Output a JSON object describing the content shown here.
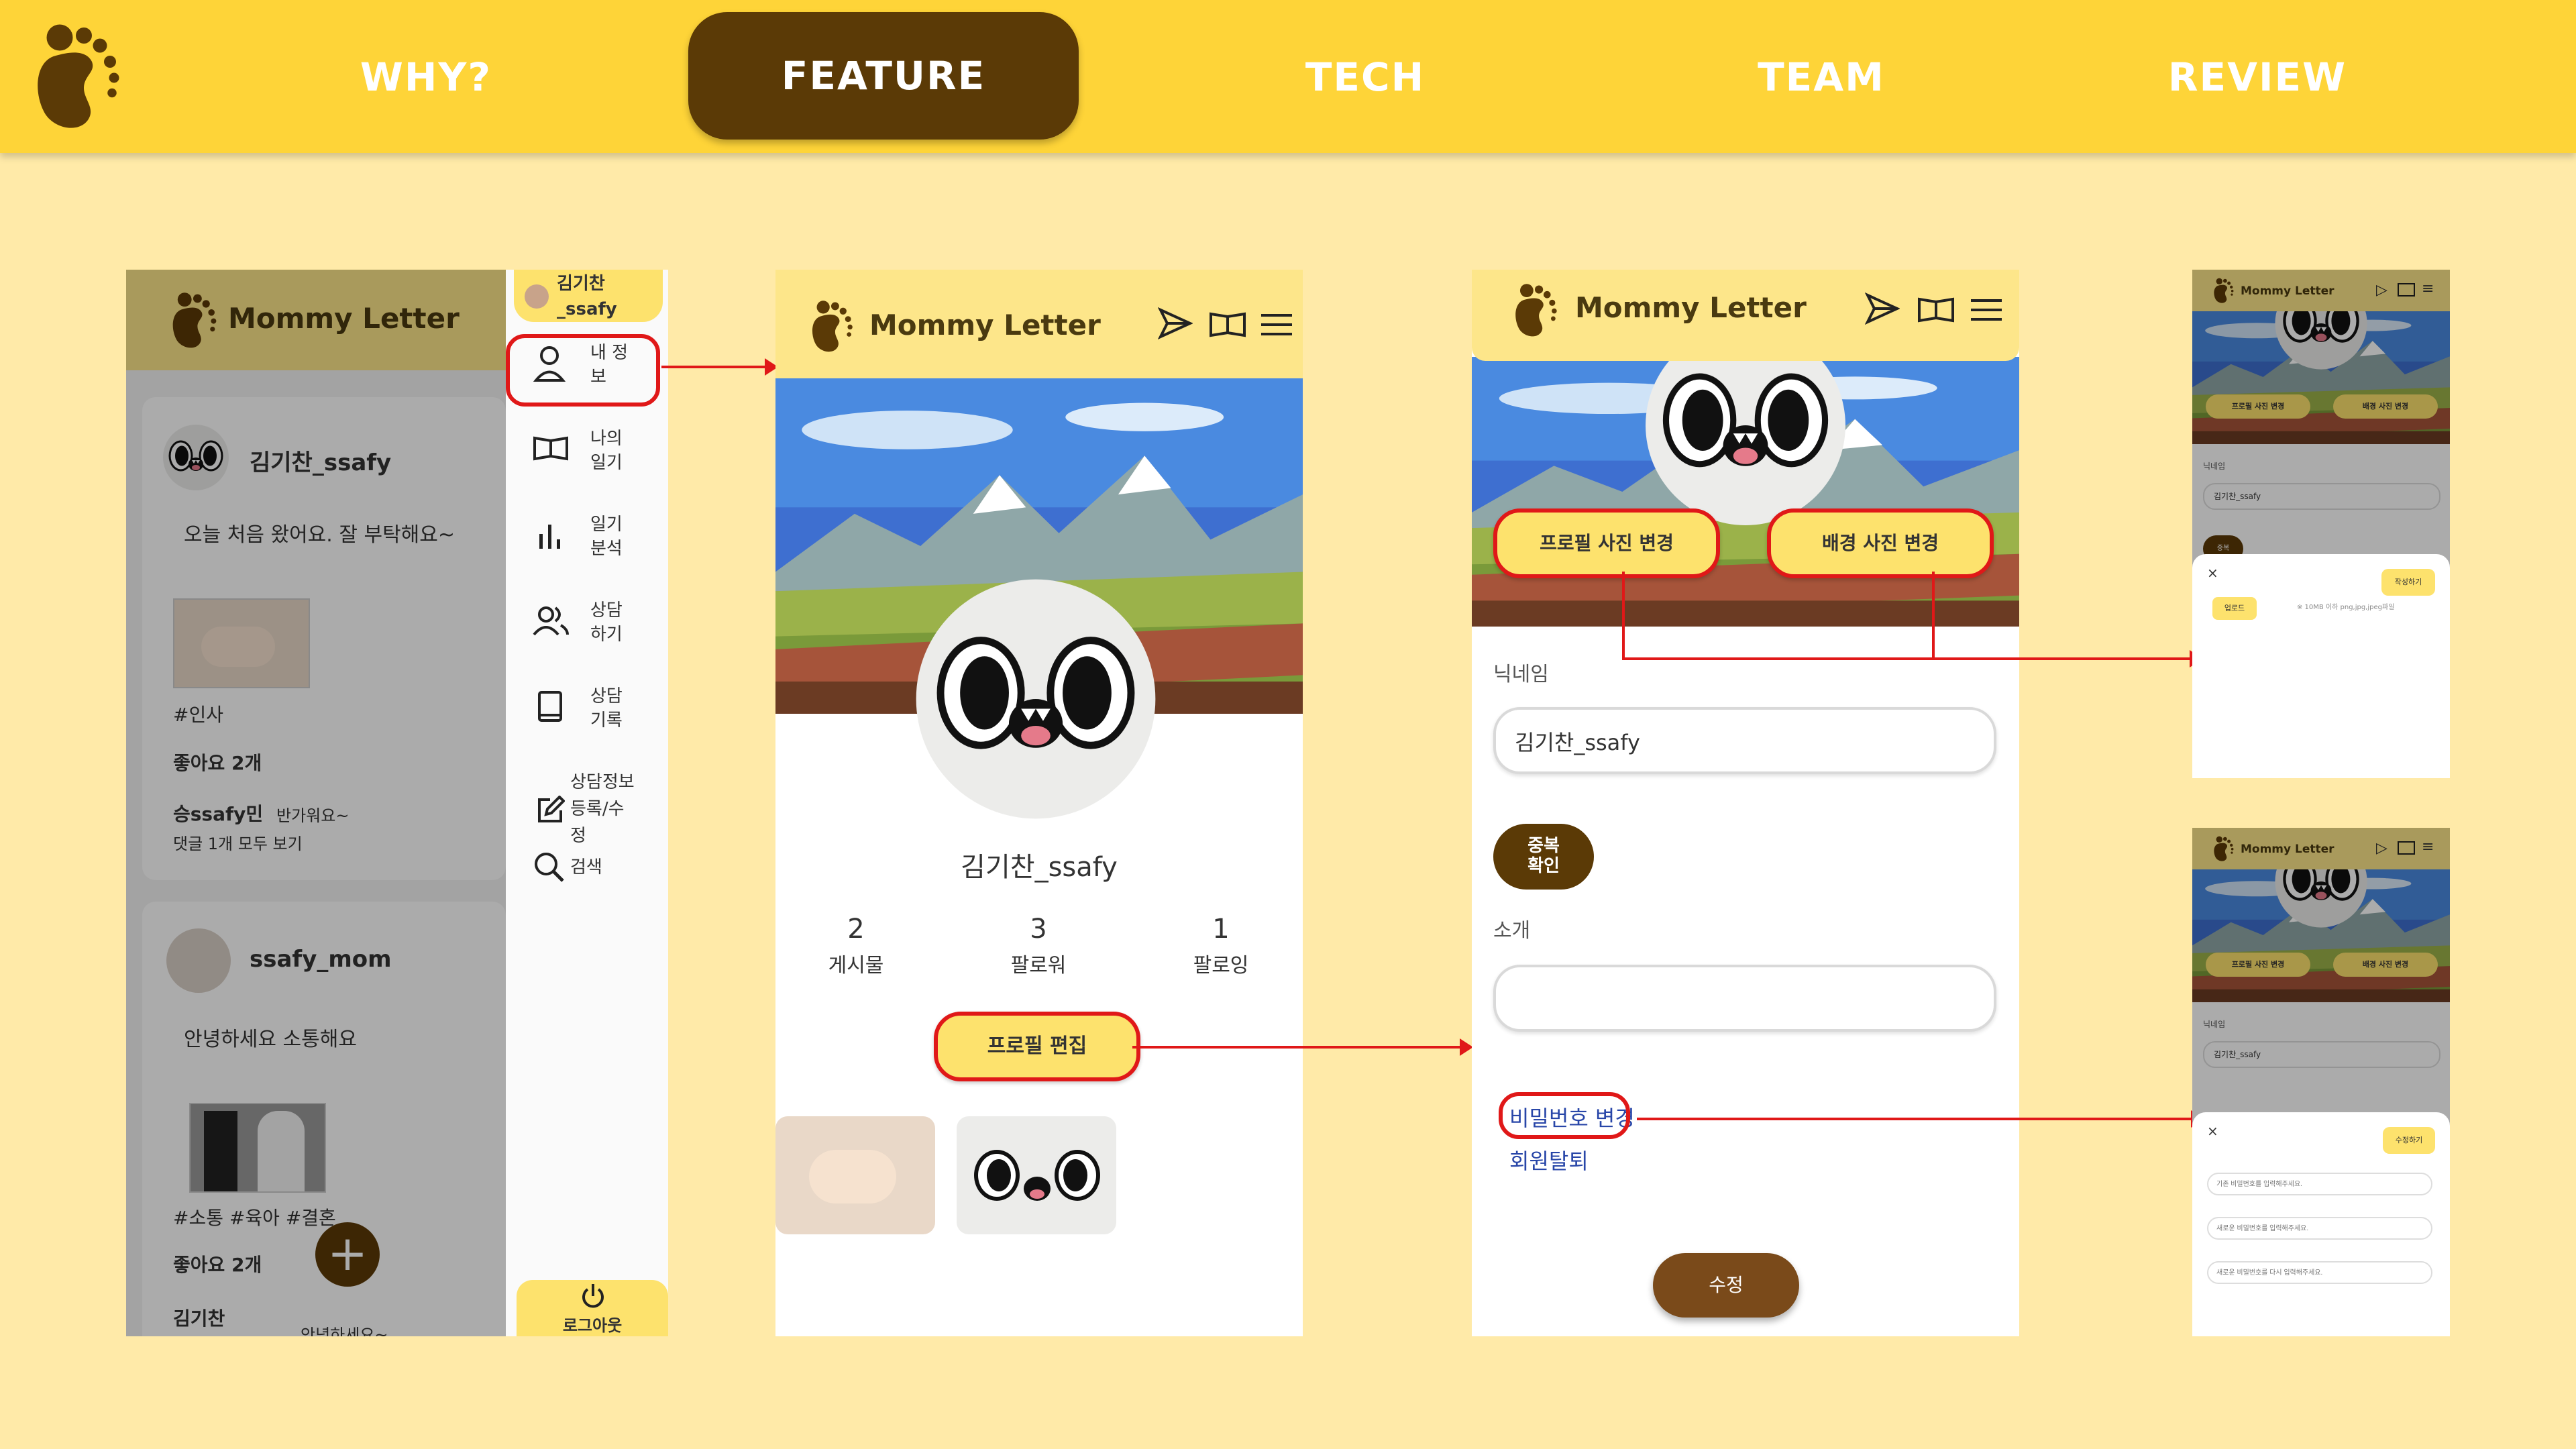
{
  "nav": {
    "items": [
      "WHY?",
      "FEATURE",
      "TECH",
      "TEAM",
      "REVIEW"
    ],
    "active": "FEATURE"
  },
  "feed": {
    "app_name": "Mommy Letter",
    "posts": [
      {
        "author": "김기찬_ssafy",
        "text": "오늘 처음 왔어요. 잘 부탁해요~",
        "tags": "#인사",
        "likes": "좋아요 2개",
        "comment_author": "승ssafy민",
        "comment_text": "반가워요~",
        "view_comments": "댓글 1개 모두 보기"
      },
      {
        "author": "ssafy_mom",
        "text": "안녕하세요 소통해요",
        "tags": "#소통 #육아 #결혼",
        "likes": "좋아요 2개",
        "comment_author": "김기찬",
        "comment_text": "안녕하세요~"
      }
    ],
    "fab": "+"
  },
  "sidebar": {
    "user": "김기찬\n_ssafy",
    "items": [
      "내 정보",
      "나의 일기",
      "일기 분석",
      "상담 하기",
      "상담 기록",
      "상담정보 등록/수정",
      "검색"
    ],
    "logout": "로그아웃"
  },
  "profile": {
    "app_name": "Mommy Letter",
    "username": "김기찬_ssafy",
    "stats": [
      {
        "value": "2",
        "label": "게시물"
      },
      {
        "value": "3",
        "label": "팔로워"
      },
      {
        "value": "1",
        "label": "팔로잉"
      }
    ],
    "edit_button": "프로필 편집"
  },
  "edit": {
    "app_name": "Mommy Letter",
    "change_profile_photo": "프로필 사진 변경",
    "change_bg_photo": "배경 사진 변경",
    "nickname_label": "닉네임",
    "nickname_value": "김기찬_ssafy",
    "dup_check": "중복\n확인",
    "intro_label": "소개",
    "intro_value": "",
    "change_password": "비밀번호 변경",
    "withdraw": "회원탈퇴",
    "submit": "수정"
  },
  "upload_modal": {
    "app_name": "Mommy Letter",
    "btn_profile": "프로필 사진 변경",
    "btn_bg": "배경 사진 변경",
    "nickname_label": "닉네임",
    "nickname_value": "김기찬_ssafy",
    "dup": "중복",
    "close": "×",
    "write": "작성하기",
    "upload": "업로드",
    "note": "※ 10MB 이하 png,jpg,jpeg파일"
  },
  "password_modal": {
    "app_name": "Mommy Letter",
    "btn_profile": "프로필 사진 변경",
    "btn_bg": "배경 사진 변경",
    "nickname_label": "닉네임",
    "nickname_value": "김기찬_ssafy",
    "close": "×",
    "submit": "수정하기",
    "current_pw_placeholder": "기존 비밀번호를 입력해주세요.",
    "new_pw_placeholder": "새로운 비밀번호를 입력해주세요.",
    "confirm_pw_placeholder": "새로운 비밀번호를 다시 입력해주세요."
  },
  "colors": {
    "nav_bg": "#FED438",
    "page_bg": "#FFEAA8",
    "brand_brown": "#5B3A06",
    "accent_red": "#E01818",
    "header_yellow": "#FDE68A"
  }
}
